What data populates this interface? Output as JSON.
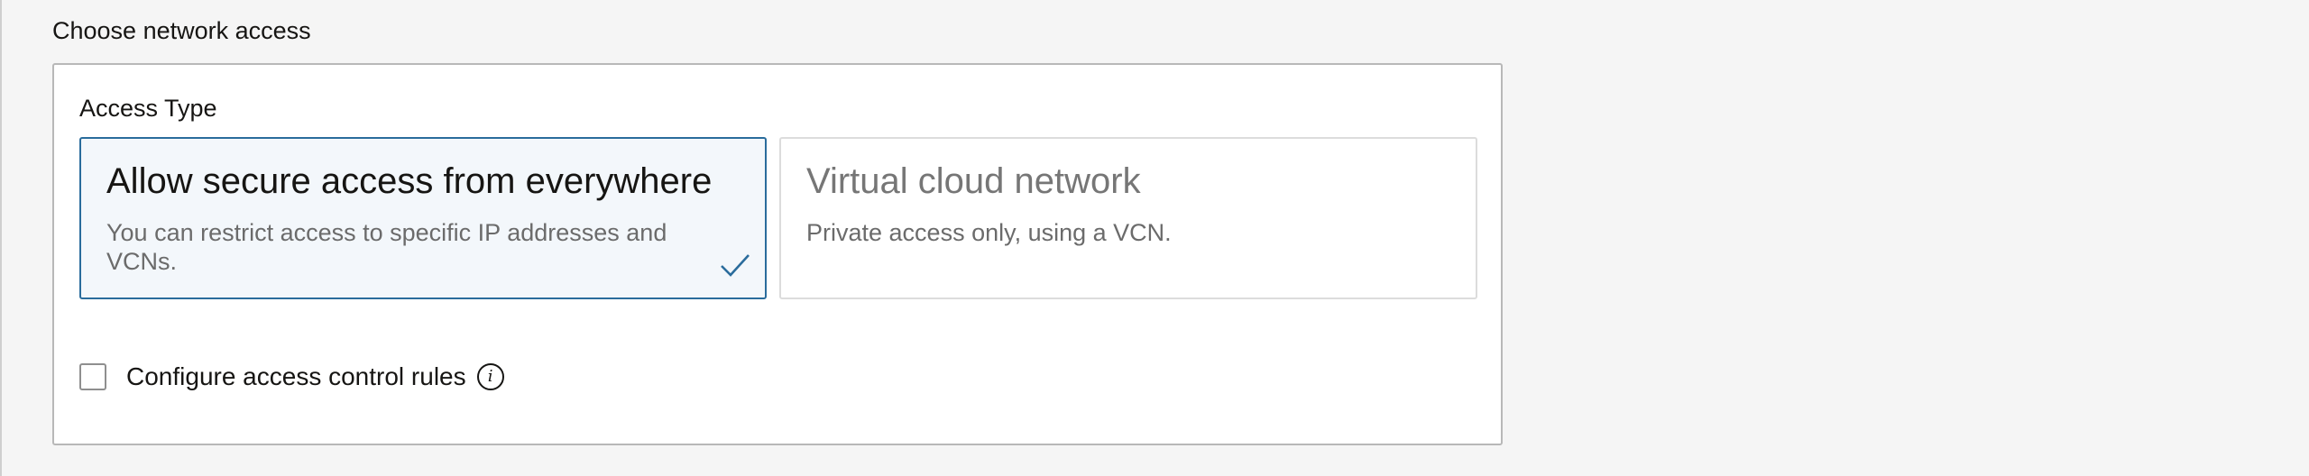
{
  "section": {
    "title": "Choose network access"
  },
  "access_type": {
    "label": "Access Type",
    "options": [
      {
        "title": "Allow secure access from everywhere",
        "description": "You can restrict access to specific IP addresses and VCNs.",
        "selected": true
      },
      {
        "title": "Virtual cloud network",
        "description": "Private access only, using a VCN.",
        "selected": false
      }
    ]
  },
  "access_control": {
    "label": "Configure access control rules",
    "checked": false,
    "info_icon": "info-icon"
  },
  "icons": {
    "selected_check": "check-icon"
  },
  "colors": {
    "selected_border": "#2a6c9c",
    "selected_background": "#f3f7fb",
    "check": "#2a6c9c"
  }
}
